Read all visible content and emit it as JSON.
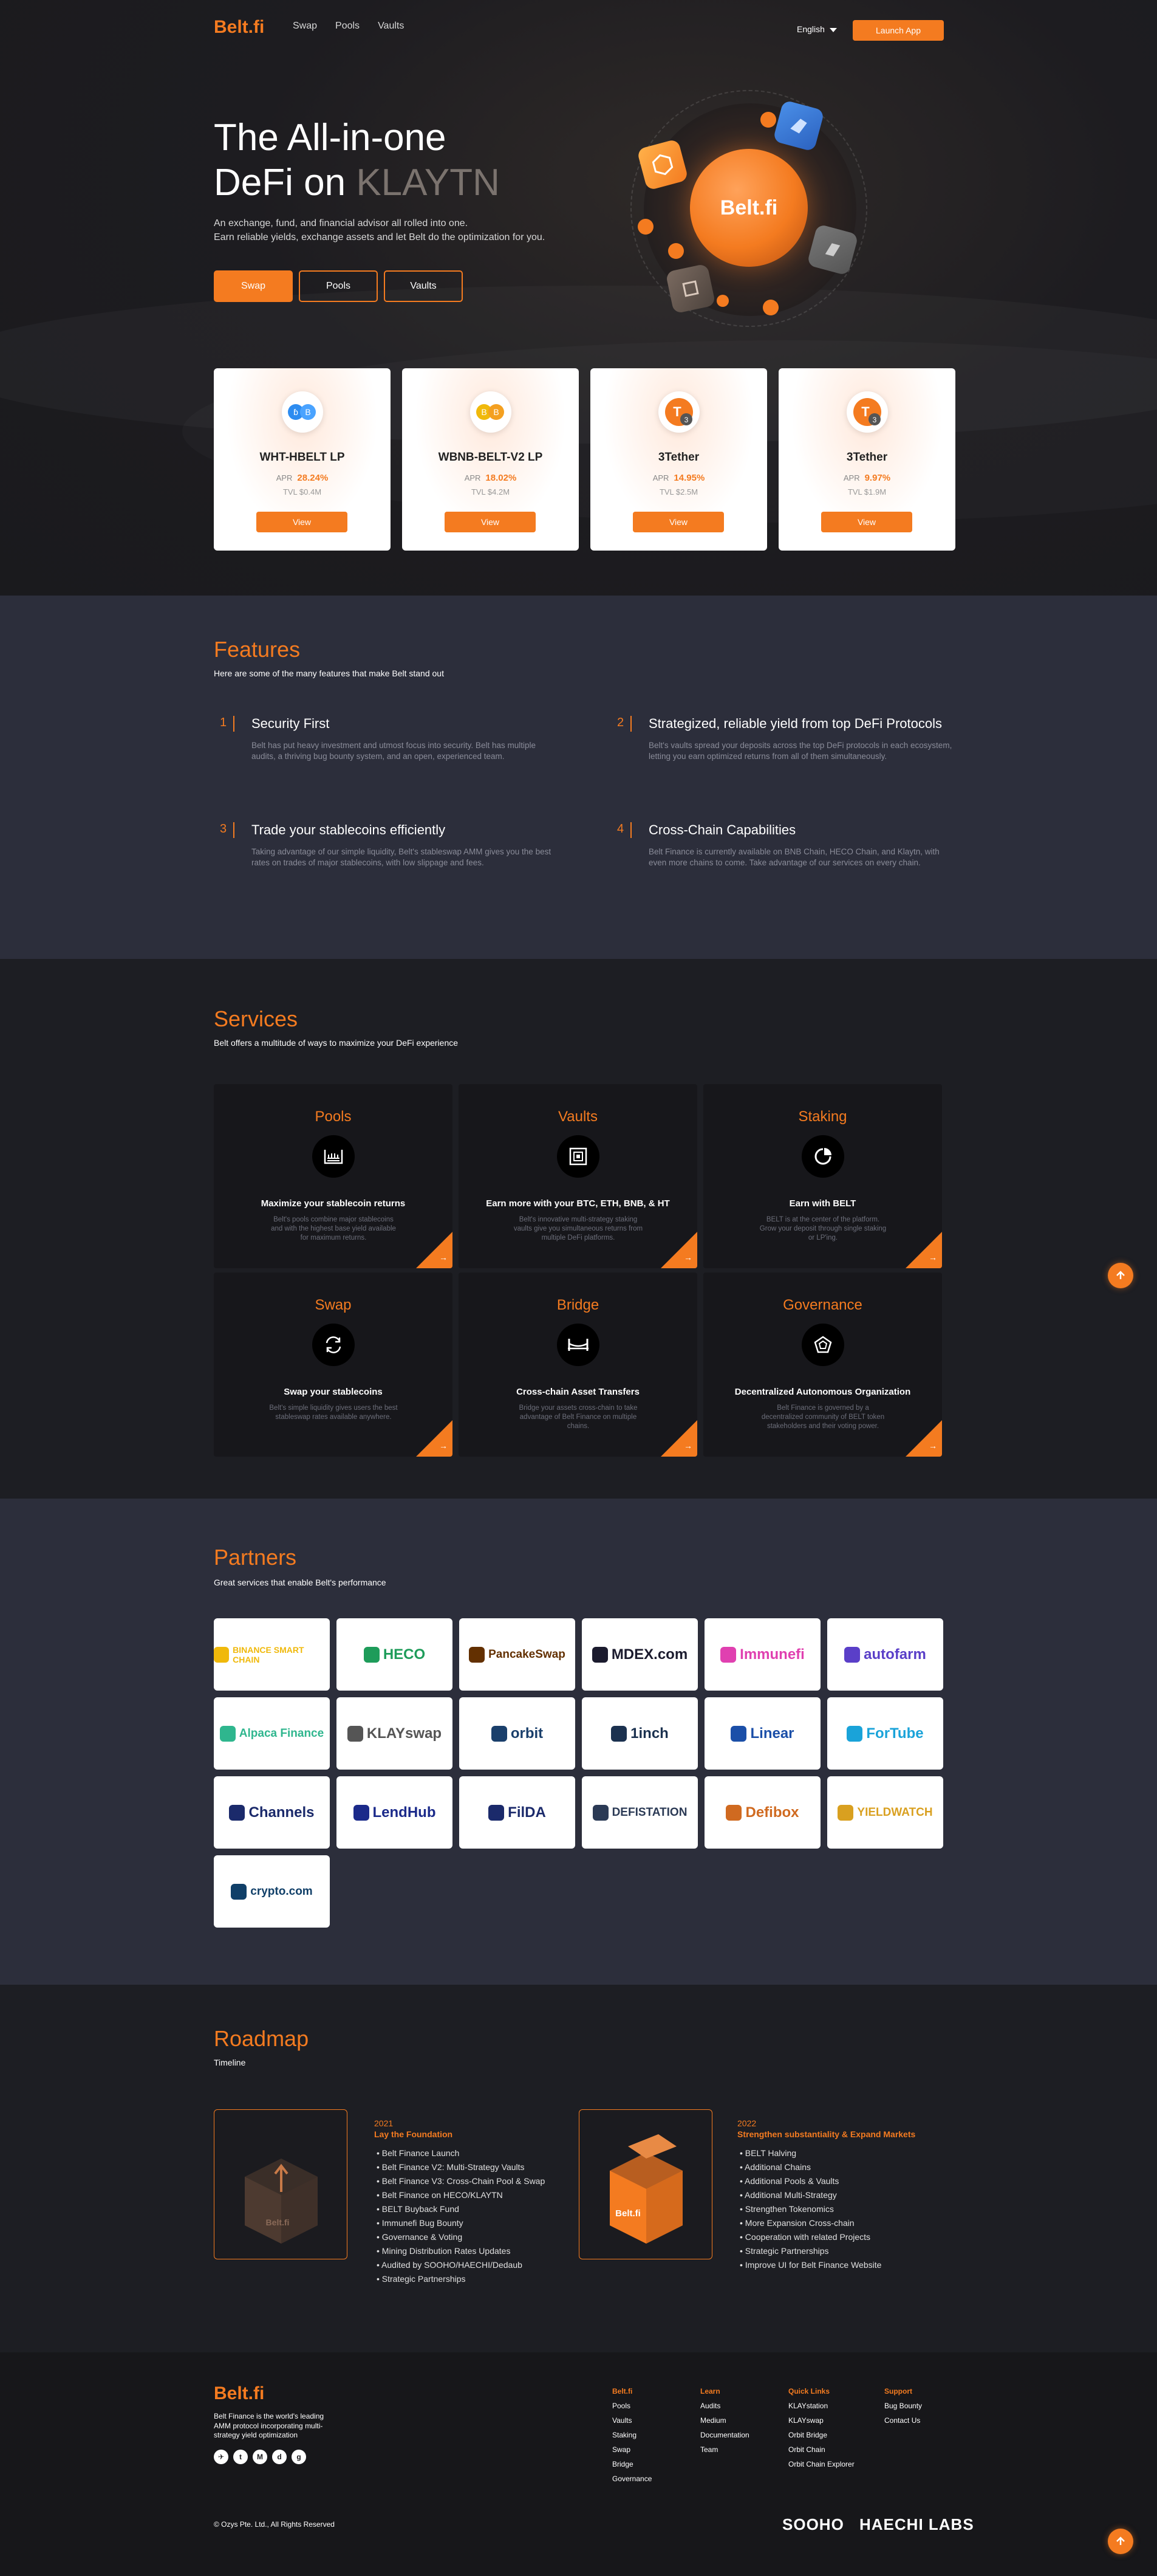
{
  "nav": {
    "logo": "Belt.fi",
    "links": [
      "Swap",
      "Pools",
      "Vaults"
    ],
    "language": "English",
    "launch": "Launch App"
  },
  "hero": {
    "title_line1": "The All-in-one",
    "title_line2_a": "DeFi on ",
    "title_line2_b": "KLAYTN",
    "sub1": "An exchange, fund, and financial advisor all rolled into one.",
    "sub2": "Earn reliable yields, exchange assets and let Belt do the optimization for you.",
    "buttons": [
      "Swap",
      "Pools",
      "Vaults"
    ],
    "sphere_label": "Belt.fi"
  },
  "pool_cards": [
    {
      "name": "WHT-HBELT LP",
      "apr_label": "APR",
      "apr": "28.24%",
      "tvl": "TVL $0.4M",
      "view": "View",
      "coin_colors": [
        "#2d8cf0",
        "#4aa3ff"
      ],
      "coin_glyphs": [
        "ɓ",
        "B"
      ]
    },
    {
      "name": "WBNB-BELT-V2 LP",
      "apr_label": "APR",
      "apr": "18.02%",
      "tvl": "TVL $4.2M",
      "view": "View",
      "coin_colors": [
        "#f0b90b",
        "#f4a020"
      ],
      "coin_glyphs": [
        "B",
        "B"
      ]
    },
    {
      "name": "3Tether",
      "apr_label": "APR",
      "apr": "14.95%",
      "tvl": "TVL $2.5M",
      "view": "View",
      "coin_colors": [
        "#f47b20"
      ],
      "coin_glyphs": [
        "T"
      ]
    },
    {
      "name": "3Tether",
      "apr_label": "APR",
      "apr": "9.97%",
      "tvl": "TVL $1.9M",
      "view": "View",
      "coin_colors": [
        "#f47b20"
      ],
      "coin_glyphs": [
        "T"
      ]
    }
  ],
  "features": {
    "title": "Features",
    "subtitle": "Here are some of the many features that make Belt stand out",
    "items": [
      {
        "num": "1",
        "title": "Security First",
        "desc": "Belt has put heavy investment and utmost focus into security. Belt has multiple audits, a thriving bug bounty system, and an open, experienced team."
      },
      {
        "num": "2",
        "title": "Strategized, reliable yield from top DeFi Protocols",
        "desc": "Belt's vaults spread your deposits across the top DeFi protocols in each ecosystem, letting you earn optimized returns from all of them simultaneously."
      },
      {
        "num": "3",
        "title": "Trade your stablecoins efficiently",
        "desc": "Taking advantage of our simple liquidity, Belt's stableswap AMM gives you the best rates on trades of major stablecoins, with low slippage and fees."
      },
      {
        "num": "4",
        "title": "Cross-Chain Capabilities",
        "desc": "Belt Finance is currently available on BNB Chain, HECO Chain, and Klaytn, with even more chains to come. Take advantage of our services on every chain."
      }
    ]
  },
  "services": {
    "title": "Services",
    "subtitle": "Belt offers a multitude of ways to maximize your DeFi experience",
    "items": [
      {
        "title": "Pools",
        "heading": "Maximize your stablecoin returns",
        "desc": "Belt's pools combine major stablecoins and with the highest base yield available for maximum returns."
      },
      {
        "title": "Vaults",
        "heading": "Earn more with your BTC, ETH, BNB, & HT",
        "desc": "Belt's innovative multi-strategy staking vaults give you simultaneous returns from multiple DeFi platforms."
      },
      {
        "title": "Staking",
        "heading": "Earn with BELT",
        "desc": "BELT is at the center of the platform. Grow your deposit through single staking or LP'ing."
      },
      {
        "title": "Swap",
        "heading": "Swap your stablecoins",
        "desc": "Belt's simple liquidity gives users the best stableswap rates available anywhere."
      },
      {
        "title": "Bridge",
        "heading": "Cross-chain Asset Transfers",
        "desc": "Bridge your assets cross-chain to take advantage of Belt Finance on multiple chains."
      },
      {
        "title": "Governance",
        "heading": "Decentralized Autonomous Organization",
        "desc": "Belt Finance is governed by a decentralized community of BELT token stakeholders and their voting power."
      }
    ]
  },
  "partners": {
    "title": "Partners",
    "subtitle": "Great services that enable Belt's performance",
    "logos": [
      {
        "name": "BINANCE SMART CHAIN",
        "color": "#f0b90b"
      },
      {
        "name": "HECO",
        "color": "#1e9c5a"
      },
      {
        "name": "PancakeSwap",
        "color": "#633001"
      },
      {
        "name": "MDEX.com",
        "color": "#1b1b2e"
      },
      {
        "name": "Immunefi",
        "color": "#e040b0"
      },
      {
        "name": "autofarm",
        "color": "#5a3fc8"
      },
      {
        "name": "Alpaca Finance",
        "color": "#2fb68e"
      },
      {
        "name": "KLAYswap",
        "color": "#555555"
      },
      {
        "name": "orbit",
        "color": "#1a3f6b"
      },
      {
        "name": "1inch",
        "color": "#1b314f"
      },
      {
        "name": "Linear",
        "color": "#1b4fa8"
      },
      {
        "name": "ForTube",
        "color": "#1aa3d9"
      },
      {
        "name": "Channels",
        "color": "#1b2a6b"
      },
      {
        "name": "LendHub",
        "color": "#1b2a8a"
      },
      {
        "name": "FilDA",
        "color": "#1b2a6b"
      },
      {
        "name": "DEFISTATION",
        "color": "#2b3a55"
      },
      {
        "name": "Defibox",
        "color": "#d06a20"
      },
      {
        "name": "YIELDWATCH",
        "color": "#d9a020"
      },
      {
        "name": "crypto.com",
        "color": "#103f68"
      }
    ]
  },
  "roadmap": {
    "title": "Roadmap",
    "subtitle": "Timeline",
    "phases": [
      {
        "year": "2021",
        "heading": "Lay the Foundation",
        "box_label": "Belt.fi",
        "items": [
          "Belt Finance Launch",
          "Belt Finance V2: Multi-Strategy Vaults",
          "Belt Finance V3: Cross-Chain Pool & Swap",
          "Belt Finance on HECO/KLAYTN",
          "BELT Buyback Fund",
          "Immunefi Bug Bounty",
          "Governance & Voting",
          "Mining Distribution Rates Updates",
          "Audited by SOOHO/HAECHI/Dedaub",
          "Strategic Partnerships"
        ]
      },
      {
        "year": "2022",
        "heading": "Strengthen substantiality & Expand Markets",
        "box_label": "Belt.fi",
        "items": [
          "BELT Halving",
          "Additional Chains",
          "Additional Pools & Vaults",
          "Additional Multi-Strategy",
          "Strengthen Tokenomics",
          "More Expansion Cross-chain",
          "Cooperation with related Projects",
          "Strategic Partnerships",
          "Improve UI for Belt Finance Website"
        ]
      }
    ]
  },
  "footer": {
    "logo": "Belt.fi",
    "desc": "Belt Finance is the world's leading AMM protocol incorporating multi-strategy yield optimization",
    "socials": [
      "telegram-icon",
      "twitter-icon",
      "medium-icon",
      "discord-icon",
      "github-icon"
    ],
    "social_glyphs": [
      "✈",
      "t",
      "M",
      "d",
      "g"
    ],
    "columns": [
      {
        "heading": "Belt.fi",
        "items": [
          "Pools",
          "Vaults",
          "Staking",
          "Swap",
          "Bridge",
          "Governance"
        ]
      },
      {
        "heading": "Learn",
        "items": [
          "Audits",
          "Medium",
          "Documentation",
          "Team"
        ]
      },
      {
        "heading": "Quick Links",
        "items": [
          "KLAYstation",
          "KLAYswap",
          "Orbit Bridge",
          "Orbit Chain",
          "Orbit Chain Explorer"
        ]
      },
      {
        "heading": "Support",
        "items": [
          "Bug Bounty",
          "Contact Us"
        ]
      }
    ],
    "copyright": "© Ozys Pte. Ltd., All Rights Reserved",
    "brands": [
      "SOOHO",
      "HAECHI LABS"
    ]
  },
  "colors": {
    "accent": "#f47b20",
    "bg_dark": "#1d1e23",
    "bg_mid": "#2c2e3b"
  }
}
